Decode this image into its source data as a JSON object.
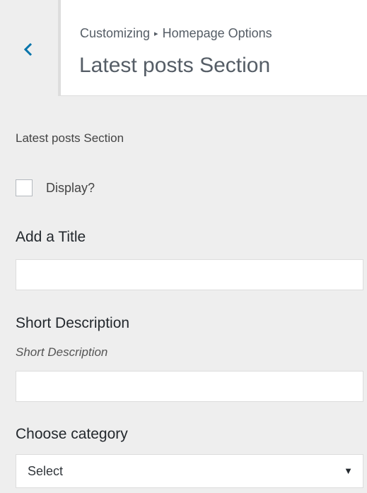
{
  "header": {
    "breadcrumb_root": "Customizing",
    "breadcrumb_separator": "▸",
    "breadcrumb_parent": "Homepage Options",
    "title": "Latest posts Section",
    "back_icon": "chevron-left-icon"
  },
  "section": {
    "description": "Latest posts Section"
  },
  "display_checkbox": {
    "label": "Display?",
    "checked": false
  },
  "title_field": {
    "label": "Add a Title",
    "value": ""
  },
  "short_description_field": {
    "label": "Short Description",
    "description": "Short Description",
    "value": ""
  },
  "category_field": {
    "label": "Choose category",
    "selected": "Select",
    "arrow_icon": "caret-down-icon"
  },
  "colors": {
    "accent": "#0073aa",
    "panel_background": "#eeeeee",
    "header_background": "#ffffff"
  }
}
